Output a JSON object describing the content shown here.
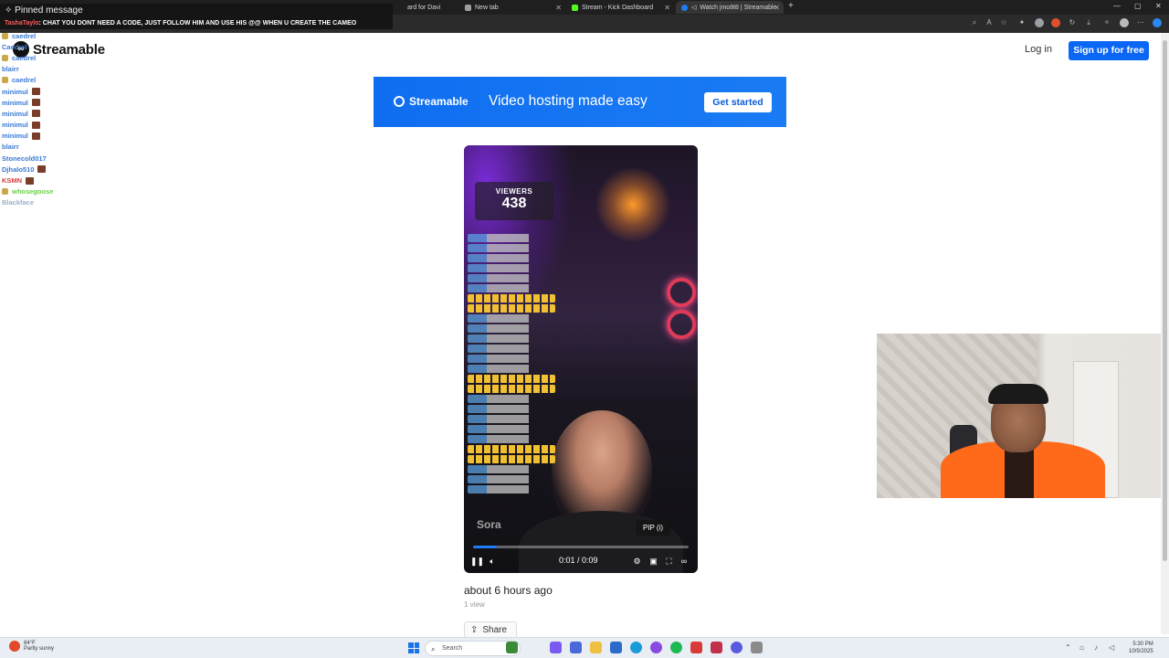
{
  "browser": {
    "tabs": [
      {
        "label": "ard for Davi",
        "active": false
      },
      {
        "label": "New tab",
        "active": false
      },
      {
        "label": "Stream - Kick Dashboard",
        "active": false
      },
      {
        "label": "Watch jmo8t8 | Streamable",
        "active": true
      }
    ]
  },
  "chat_overlay": {
    "pinned_title": "Pinned message",
    "pinned_user": "TashaTaylo",
    "pinned_text": ": CHAT YOU DONT NEED A CODE, JUST FOLLOW HIM AND USE HIS @@ WHEN U CREATE THE CAMEO",
    "messages": [
      {
        "user": "caedrel",
        "color": "#3a7bd5"
      },
      {
        "user": "Caedrel",
        "color": "#3a7bd5"
      },
      {
        "user": "caedrel",
        "color": "#3a7bd5"
      },
      {
        "user": "blairr",
        "color": "#3a7bd5"
      },
      {
        "user": "caedrel",
        "color": "#3a7bd5"
      },
      {
        "user": "minimul",
        "color": "#3a7bd5"
      },
      {
        "user": "minimul",
        "color": "#3a7bd5"
      },
      {
        "user": "minimul",
        "color": "#3a7bd5"
      },
      {
        "user": "minimul",
        "color": "#3a7bd5"
      },
      {
        "user": "minimul",
        "color": "#3a7bd5"
      },
      {
        "user": "blairr",
        "color": "#3a7bd5"
      },
      {
        "user": "Stonecold017",
        "color": "#3a7bd5"
      },
      {
        "user": "Djhalo510",
        "color": "#3a7bd5"
      },
      {
        "user": "KSMN",
        "color": "#d63a3a"
      },
      {
        "user": "whosegoose",
        "color": "#6ccf4a"
      },
      {
        "user": "Blackface",
        "color": "#9ab0c8"
      }
    ]
  },
  "header": {
    "logo_text": "Streamable",
    "login_label": "Log in",
    "signup_label": "Sign up for free"
  },
  "banner": {
    "logo_text": "Streamable",
    "tagline": "Video hosting made easy",
    "cta_label": "Get started"
  },
  "video": {
    "viewers_label": "VIEWERS",
    "viewers_count": "438",
    "watermark": "Sora",
    "tooltip": "PIP (i)",
    "time": "0:01 / 0:09",
    "progress": 0.11
  },
  "meta": {
    "posted": "about 6 hours ago",
    "views": "1 view",
    "share_label": "Share"
  },
  "taskbar": {
    "weather_temp": "84°F",
    "weather_desc": "Partly sunny",
    "search_placeholder": "Search",
    "time": "5:30 PM",
    "date": "10/5/2025"
  },
  "colors": {
    "accent": "#0a66f4",
    "banner": "#0f6ef0",
    "progress": "#1e7cf5"
  }
}
